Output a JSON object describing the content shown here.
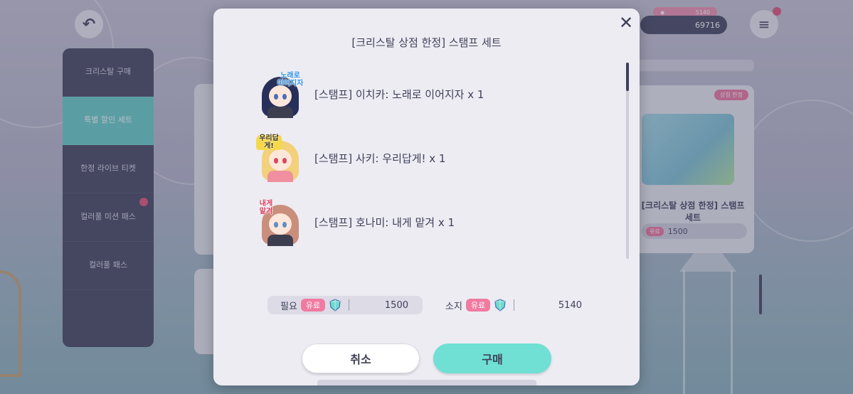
{
  "background": {
    "side_menu": [
      {
        "label": "크리스탈 구매",
        "active": false
      },
      {
        "label": "특별 할인 세트",
        "active": true
      },
      {
        "label": "한정 라이브 티켓",
        "active": false
      },
      {
        "label": "컬러풀 미션 패스",
        "active": false,
        "badge": true
      },
      {
        "label": "컬러풀 패스",
        "active": false
      }
    ],
    "currency_value": "69716",
    "currency_paid": "5140",
    "product_card": {
      "tag": "상점 한정",
      "name": "[크리스탈 상점 한정] 스탬프 세트",
      "price": "1500",
      "paid_label": "유료"
    }
  },
  "dialog": {
    "title": "[크리스탈 상점 한정] 스탬프 세트",
    "close_icon": "close-icon",
    "items": [
      {
        "label": "[스탬프] 이치카: 노래로 이어지자 x 1",
        "stamp_text": "노래로 이어지자"
      },
      {
        "label": "[스탬프] 사키: 우리답게! x 1",
        "stamp_text": "우리답게!"
      },
      {
        "label": "[스탬프] 호나미: 내게 맡겨 x 1",
        "stamp_text": "내게 맡겨"
      }
    ],
    "required": {
      "label": "필요",
      "badge": "유료",
      "value": "1500"
    },
    "owned": {
      "label": "소지",
      "badge": "유료",
      "value": "5140"
    },
    "cancel_label": "취소",
    "buy_label": "구매"
  },
  "colors": {
    "accent_mint": "#6fe0d3",
    "paid_pink": "#f07aa0",
    "dialog_bg": "#edecf3",
    "text_dark": "#3f4058"
  }
}
